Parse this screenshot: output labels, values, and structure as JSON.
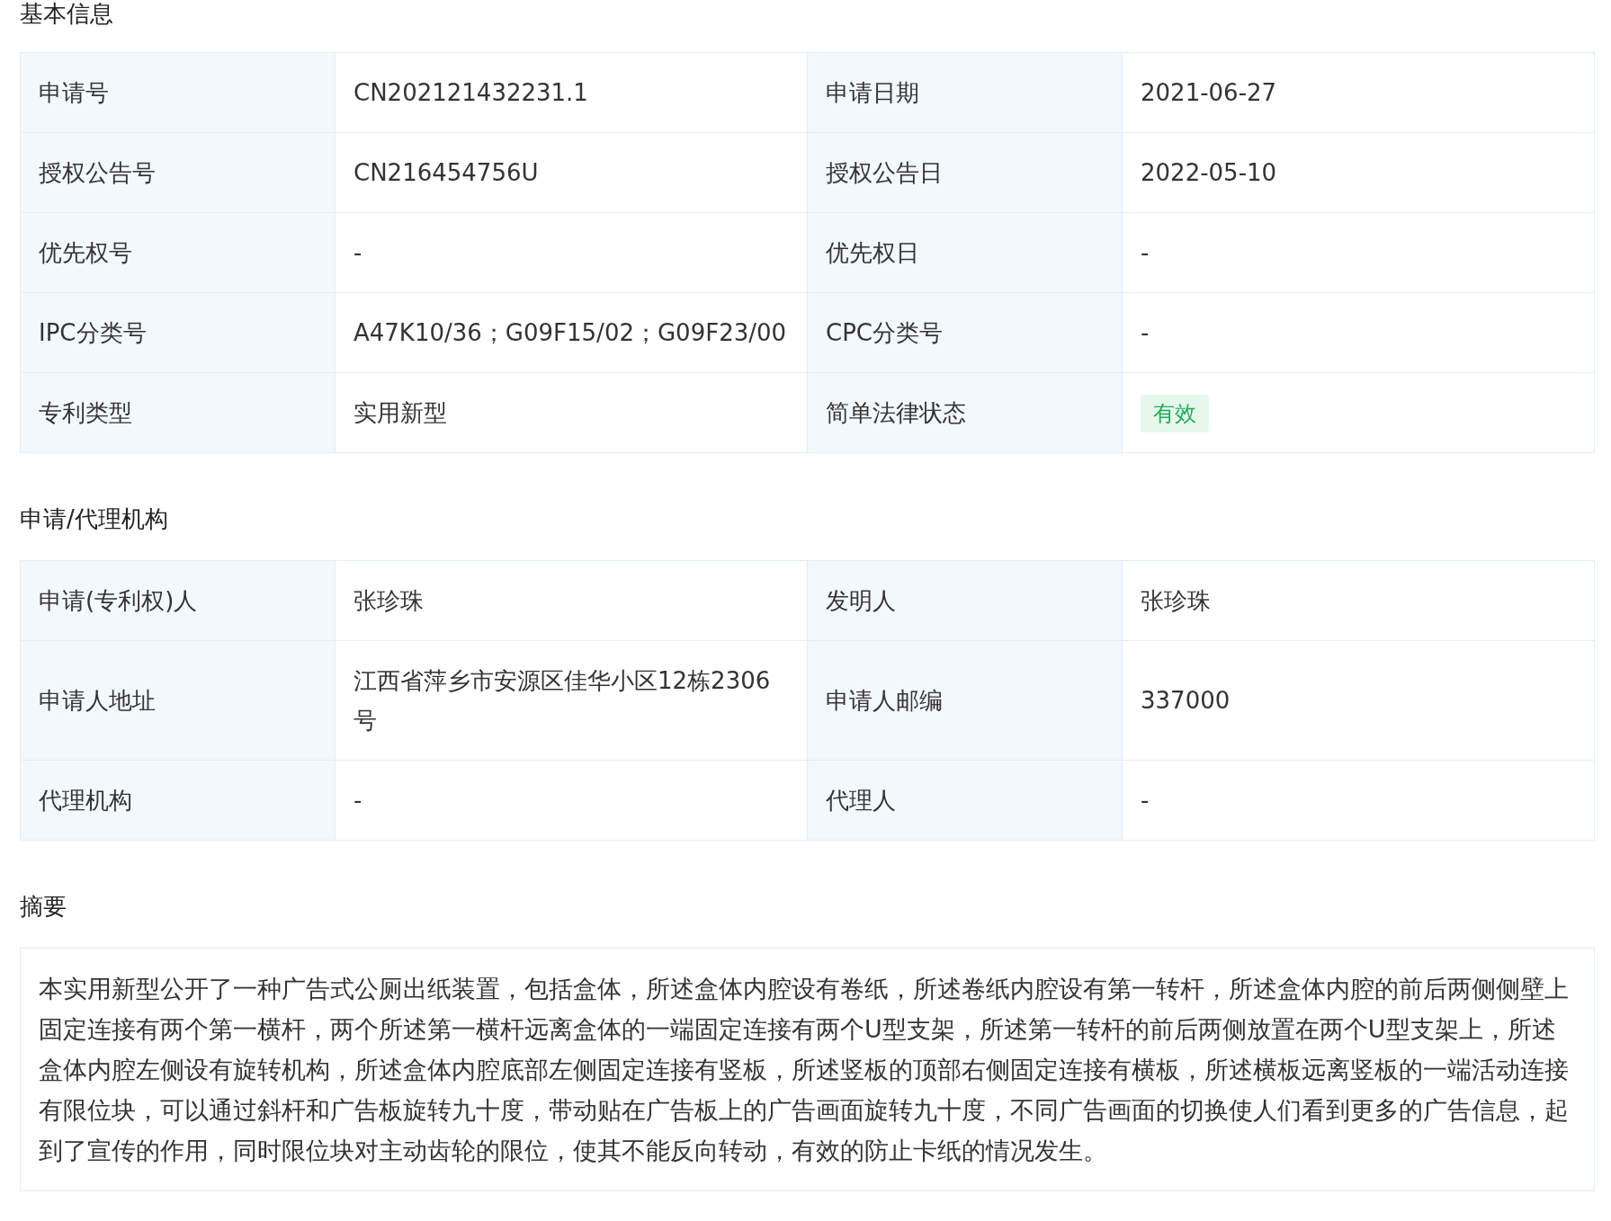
{
  "sections": [
    {
      "kind": "table",
      "title": "基本信息",
      "rows": [
        {
          "cells": [
            {
              "label": "申请号",
              "value": "CN202121432231.1",
              "kind": "text"
            },
            {
              "label": "申请日期",
              "value": "2021-06-27",
              "kind": "text"
            }
          ]
        },
        {
          "cells": [
            {
              "label": "授权公告号",
              "value": "CN216454756U",
              "kind": "text"
            },
            {
              "label": "授权公告日",
              "value": "2022-05-10",
              "kind": "text"
            }
          ]
        },
        {
          "cells": [
            {
              "label": "优先权号",
              "value": "-",
              "kind": "text"
            },
            {
              "label": "优先权日",
              "value": "-",
              "kind": "text"
            }
          ]
        },
        {
          "cells": [
            {
              "label": "IPC分类号",
              "value": "A47K10/36；G09F15/02；G09F23/00",
              "kind": "text"
            },
            {
              "label": "CPC分类号",
              "value": "-",
              "kind": "text"
            }
          ]
        },
        {
          "cells": [
            {
              "label": "专利类型",
              "value": "实用新型",
              "kind": "text"
            },
            {
              "label": "简单法律状态",
              "value": "有效",
              "kind": "badge"
            }
          ]
        }
      ]
    },
    {
      "kind": "table",
      "title": "申请/代理机构",
      "rows": [
        {
          "cells": [
            {
              "label": "申请(专利权)人",
              "value": "张珍珠",
              "kind": "text"
            },
            {
              "label": "发明人",
              "value": "张珍珠",
              "kind": "text"
            }
          ]
        },
        {
          "cells": [
            {
              "label": "申请人地址",
              "value": "江西省萍乡市安源区佳华小区12栋2306号",
              "kind": "text"
            },
            {
              "label": "申请人邮编",
              "value": "337000",
              "kind": "text"
            }
          ]
        },
        {
          "cells": [
            {
              "label": "代理机构",
              "value": "-",
              "kind": "text"
            },
            {
              "label": "代理人",
              "value": "-",
              "kind": "text"
            }
          ]
        }
      ]
    },
    {
      "kind": "text",
      "title": "摘要",
      "text": "本实用新型公开了一种广告式公厕出纸装置，包括盒体，所述盒体内腔设有卷纸，所述卷纸内腔设有第一转杆，所述盒体内腔的前后两侧侧壁上固定连接有两个第一横杆，两个所述第一横杆远离盒体的一端固定连接有两个U型支架，所述第一转杆的前后两侧放置在两个U型支架上，所述盒体内腔左侧设有旋转机构，所述盒体内腔底部左侧固定连接有竖板，所述竖板的顶部右侧固定连接有横板，所述横板远离竖板的一端活动连接有限位块，可以通过斜杆和广告板旋转九十度，带动贴在广告板上的广告画面旋转九十度，不同广告画面的切换使人们看到更多的广告信息，起到了宣传的作用，同时限位块对主动齿轮的限位，使其不能反向转动，有效的防止卡纸的情况发生。"
    }
  ]
}
